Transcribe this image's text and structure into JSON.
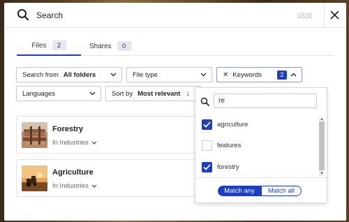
{
  "search": {
    "placeholder": "Search",
    "clear_label": "clear"
  },
  "tabs": [
    {
      "label": "Files",
      "count": "2"
    },
    {
      "label": "Shares",
      "count": "0"
    }
  ],
  "filters": {
    "search_from_label": "Search from",
    "search_from_value": "All folders",
    "file_type_label": "File type",
    "keywords_label": "Keywords",
    "keywords_count": "2",
    "languages_label": "Languages",
    "sort_label": "Sort by",
    "sort_value": "Most relevant",
    "sort_direction_glyph": "↓"
  },
  "results": [
    {
      "title": "Forestry",
      "category": "In Industries"
    },
    {
      "title": "Agriculture",
      "category": "In Industries"
    }
  ],
  "keyword_dropdown": {
    "query": "re",
    "options": [
      {
        "label": "agriculture",
        "checked": true
      },
      {
        "label": "features",
        "checked": false
      },
      {
        "label": "forestry",
        "checked": true
      }
    ],
    "match_any_label": "Match any",
    "match_all_label": "Match all"
  },
  "colors": {
    "accent": "#1d3fbf",
    "badge_bg": "#e4e7f2",
    "clear_link": "#b8bfd8"
  },
  "icons": [
    "search-icon",
    "close-icon",
    "chevron-down-icon",
    "chevron-up-icon",
    "arrow-down-icon",
    "check-icon"
  ]
}
